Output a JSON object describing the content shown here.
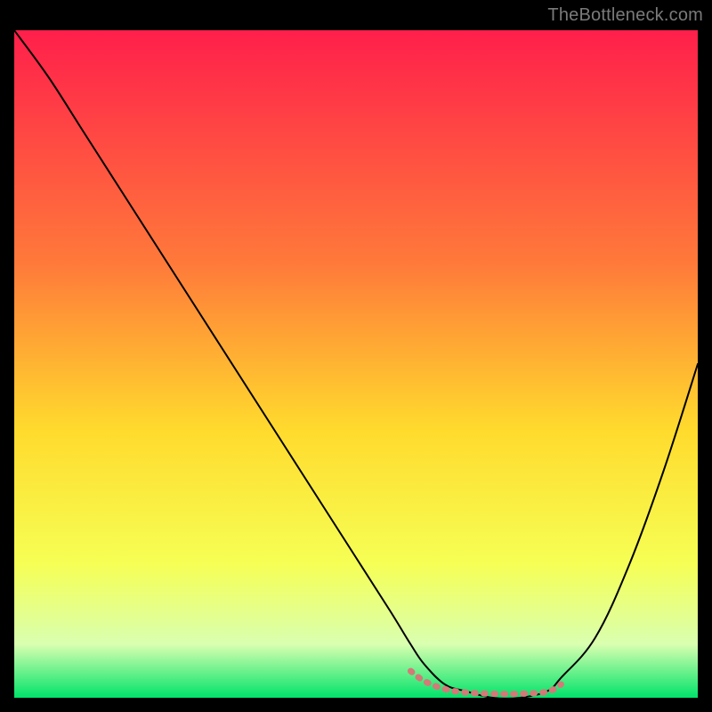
{
  "watermark": "TheBottleneck.com",
  "chart_data": {
    "type": "line",
    "title": "",
    "xlabel": "",
    "ylabel": "",
    "xlim": [
      0,
      100
    ],
    "ylim": [
      0,
      100
    ],
    "grid": false,
    "legend": false,
    "background_gradient": {
      "stops": [
        {
          "offset": 0.0,
          "color": "#ff1f4b"
        },
        {
          "offset": 0.35,
          "color": "#ff7a3a"
        },
        {
          "offset": 0.6,
          "color": "#ffdb2d"
        },
        {
          "offset": 0.8,
          "color": "#f6ff55"
        },
        {
          "offset": 0.92,
          "color": "#d9ffb0"
        },
        {
          "offset": 1.0,
          "color": "#00e36a"
        }
      ]
    },
    "series": [
      {
        "name": "bottleneck-curve",
        "color": "#000000",
        "stroke_width": 2,
        "x": [
          0,
          5,
          10,
          15,
          20,
          25,
          30,
          35,
          40,
          45,
          50,
          55,
          58,
          60,
          63,
          66,
          70,
          74,
          78,
          80,
          85,
          90,
          95,
          100
        ],
        "y": [
          100,
          93,
          85,
          77,
          69,
          61,
          53,
          45,
          37,
          29,
          21,
          13,
          8,
          5,
          2,
          1,
          0,
          0,
          1,
          3,
          9,
          20,
          34,
          50
        ]
      },
      {
        "name": "optimal-range-marker",
        "color": "#d37a78",
        "stroke_width": 7,
        "x": [
          58,
          60,
          63,
          66,
          70,
          74,
          78,
          80
        ],
        "y": [
          4.0,
          2.5,
          1.3,
          0.8,
          0.6,
          0.6,
          0.9,
          2.0
        ]
      }
    ]
  }
}
